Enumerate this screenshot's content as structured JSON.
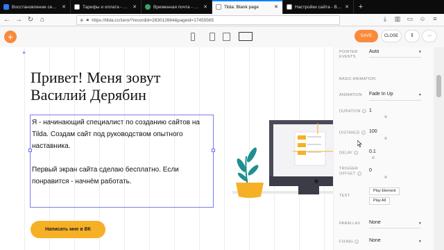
{
  "browser": {
    "tabs": [
      {
        "title": "Восстановление сессии",
        "active": false
      },
      {
        "title": "Тарифы и оплата - Tilda",
        "active": false
      },
      {
        "title": "Временная почта - TempMail",
        "active": false
      },
      {
        "title": "Tilda: Blank page",
        "active": true
      },
      {
        "title": "Настройки сайта - Василий Д",
        "active": false
      }
    ],
    "new_tab": "+",
    "url": "https://tilda.cc/zero/?recordid=283012664&pageid=17455565"
  },
  "toolbar": {
    "add": "+",
    "save": "SAVE",
    "close": "CLOSE",
    "arrows": "⇕",
    "more": "..."
  },
  "canvas": {
    "heading_line1": "Привет! Меня зовут",
    "heading_line2": "Василий Дерябин",
    "para1_line1": "Я - начинающий специалист по созданию сайтов на",
    "para1_line2": "Tilda. Создам сайт под руководством опытного",
    "para1_line3": "наставника.",
    "para2_line1": "Первый экран сайта сделаю бесплатно. Если",
    "para2_line2": "понравится - начнём работать.",
    "cta": "Написать мне в ВК"
  },
  "panel": {
    "pointer_events_label_1": "POINTER",
    "pointer_events_label_2": "EVENTS",
    "pointer_events_value": "Auto",
    "basic_animation_header": "BASIC ANIMATION",
    "animation_label": "ANIMATION",
    "animation_value": "Fade In Up",
    "duration_label": "DURATION",
    "duration_value": "1",
    "distance_label": "DISTANCE",
    "distance_value": "100",
    "delay_label": "DELAY",
    "delay_value": "0.1",
    "trigger_offset_label_1": "TRIGGER",
    "trigger_offset_label_2": "OFFSET",
    "trigger_offset_value": "0",
    "test_label": "TEST",
    "play_element": "Play Element",
    "play_all": "Play All",
    "parallax_label": "PARALLAX",
    "parallax_value": "None",
    "fixing_label": "FIXING",
    "fixing_value": "None"
  },
  "colors": {
    "accent": "#fa8a3b",
    "cta": "#f6b026",
    "selection": "#7b7bf3"
  }
}
